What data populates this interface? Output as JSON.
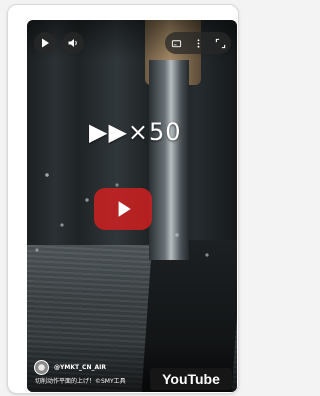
{
  "player": {
    "speed_label": "▶▶×50",
    "channel_handle": "@YMKT_CN_AIR",
    "caption": "切削动作平面的上げ！©SMY工具",
    "brand": "YouTube"
  },
  "icons": {
    "play": "play-icon",
    "volume": "volume-icon",
    "captions": "captions-icon",
    "more": "more-vertical-icon",
    "fullscreen": "fullscreen-icon",
    "big_play": "youtube-play-icon"
  },
  "colors": {
    "youtube_red": "#d52020",
    "control_bg": "#282828"
  }
}
